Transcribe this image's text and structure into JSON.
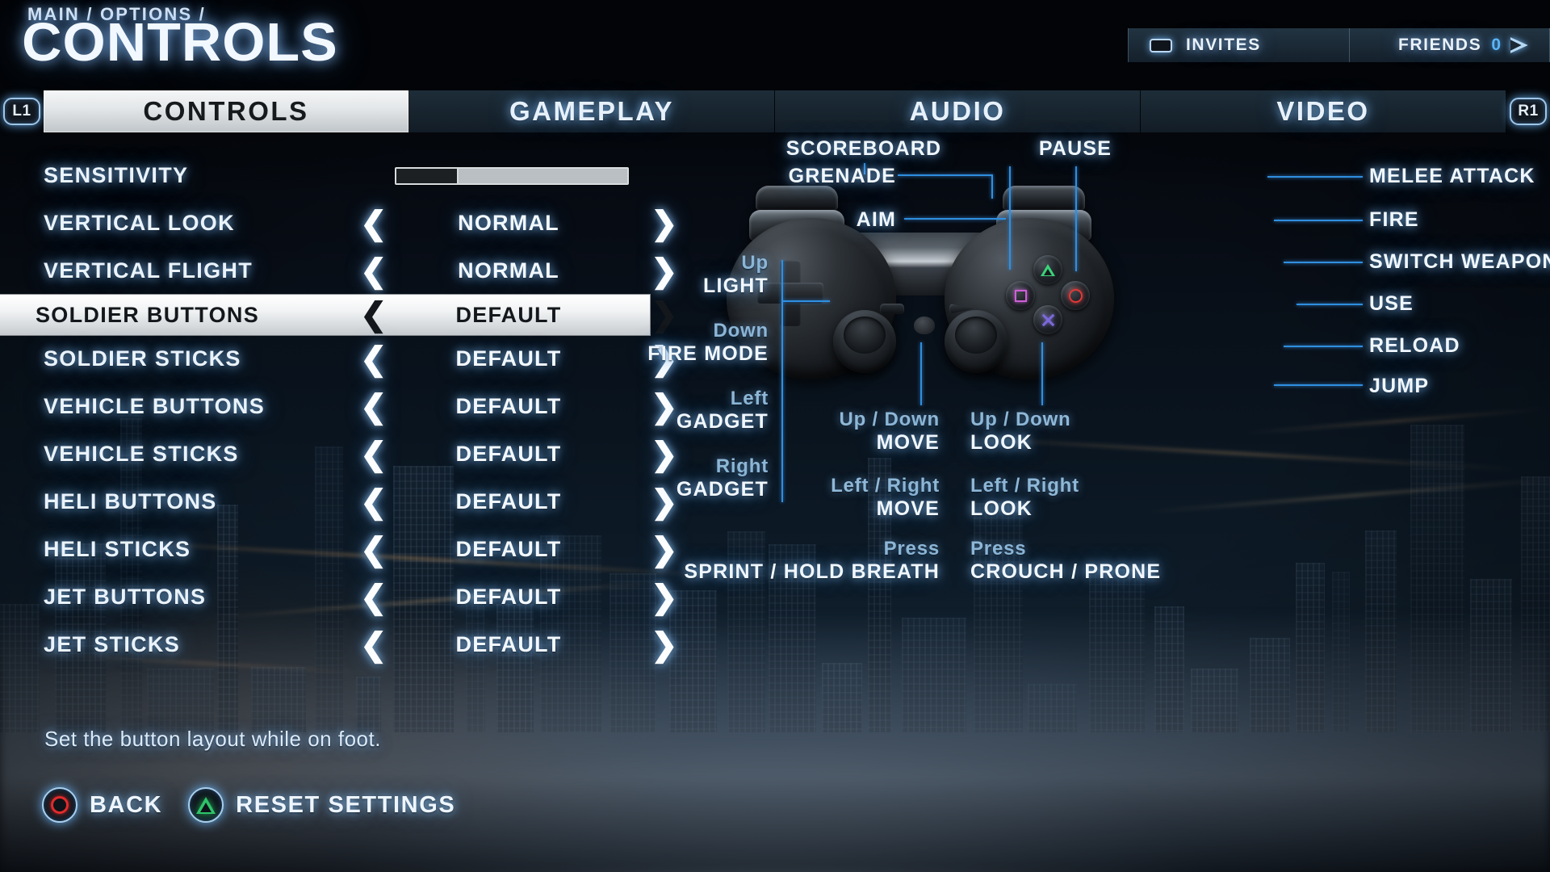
{
  "header": {
    "breadcrumb": "MAIN / OPTIONS /",
    "title": "CONTROLS"
  },
  "topbar": {
    "invites_label": "INVITES",
    "invites_icon": "invite-card-icon",
    "friends_label": "FRIENDS",
    "friends_count": "0",
    "friends_icon": "send-arrow-icon"
  },
  "tabs": {
    "left_bumper": "L1",
    "right_bumper": "R1",
    "items": [
      {
        "label": "CONTROLS",
        "active": true
      },
      {
        "label": "GAMEPLAY",
        "active": false
      },
      {
        "label": "AUDIO",
        "active": false
      },
      {
        "label": "VIDEO",
        "active": false
      }
    ]
  },
  "settings": {
    "rows": [
      {
        "name": "SENSITIVITY",
        "type": "slider",
        "value": "",
        "percent": 27,
        "selected": false
      },
      {
        "name": "VERTICAL LOOK",
        "type": "spinner",
        "value": "NORMAL",
        "selected": false
      },
      {
        "name": "VERTICAL FLIGHT",
        "type": "spinner",
        "value": "NORMAL",
        "selected": false
      },
      {
        "name": "SOLDIER BUTTONS",
        "type": "spinner",
        "value": "DEFAULT",
        "selected": true
      },
      {
        "name": "SOLDIER STICKS",
        "type": "spinner",
        "value": "DEFAULT",
        "selected": false
      },
      {
        "name": "VEHICLE BUTTONS",
        "type": "spinner",
        "value": "DEFAULT",
        "selected": false
      },
      {
        "name": "VEHICLE STICKS",
        "type": "spinner",
        "value": "DEFAULT",
        "selected": false
      },
      {
        "name": "HELI BUTTONS",
        "type": "spinner",
        "value": "DEFAULT",
        "selected": false
      },
      {
        "name": "HELI STICKS",
        "type": "spinner",
        "value": "DEFAULT",
        "selected": false
      },
      {
        "name": "JET BUTTONS",
        "type": "spinner",
        "value": "DEFAULT",
        "selected": false
      },
      {
        "name": "JET STICKS",
        "type": "spinner",
        "value": "DEFAULT",
        "selected": false
      }
    ],
    "arrow_left": "❮",
    "arrow_right": "❯"
  },
  "description": "Set the button layout while on foot.",
  "footer": {
    "back_label": "BACK",
    "back_icon": "ps-circle-icon",
    "reset_label": "RESET SETTINGS",
    "reset_icon": "ps-triangle-icon"
  },
  "diagram": {
    "title": "dualshock-controller-map",
    "labels": {
      "scoreboard": "SCOREBOARD",
      "pause": "PAUSE",
      "grenade": "GRENADE",
      "aim": "AIM",
      "melee": "MELEE ATTACK",
      "fire": "FIRE",
      "switch_weapon": "SWITCH WEAPON",
      "use": "USE",
      "reload": "RELOAD",
      "jump": "JUMP",
      "dpad_up_dir": "Up",
      "dpad_up_act": "LIGHT",
      "dpad_down_dir": "Down",
      "dpad_down_act": "FIRE MODE",
      "dpad_left_dir": "Left",
      "dpad_left_act": "GADGET",
      "dpad_right_dir": "Right",
      "dpad_right_act": "GADGET",
      "lstick_ud_dir": "Up / Down",
      "lstick_ud_act": "MOVE",
      "lstick_lr_dir": "Left / Right",
      "lstick_lr_act": "MOVE",
      "lstick_press_dir": "Press",
      "lstick_press_act": "SPRINT / HOLD BREATH",
      "rstick_ud_dir": "Up / Down",
      "rstick_ud_act": "LOOK",
      "rstick_lr_dir": "Left / Right",
      "rstick_lr_act": "LOOK",
      "rstick_press_dir": "Press",
      "rstick_press_act": "CROUCH / PRONE"
    }
  },
  "colors": {
    "accent_blue": "#2f8fe0",
    "glow_blue": "#8fb8d8",
    "text_white": "#f0f7ff",
    "highlight_bg": "#ffffff",
    "ps_circle_red": "#e02b2b",
    "ps_triangle_green": "#2fc46a",
    "ps_square_pink": "#d05fd8",
    "ps_cross_purple": "#7b6ad8"
  }
}
